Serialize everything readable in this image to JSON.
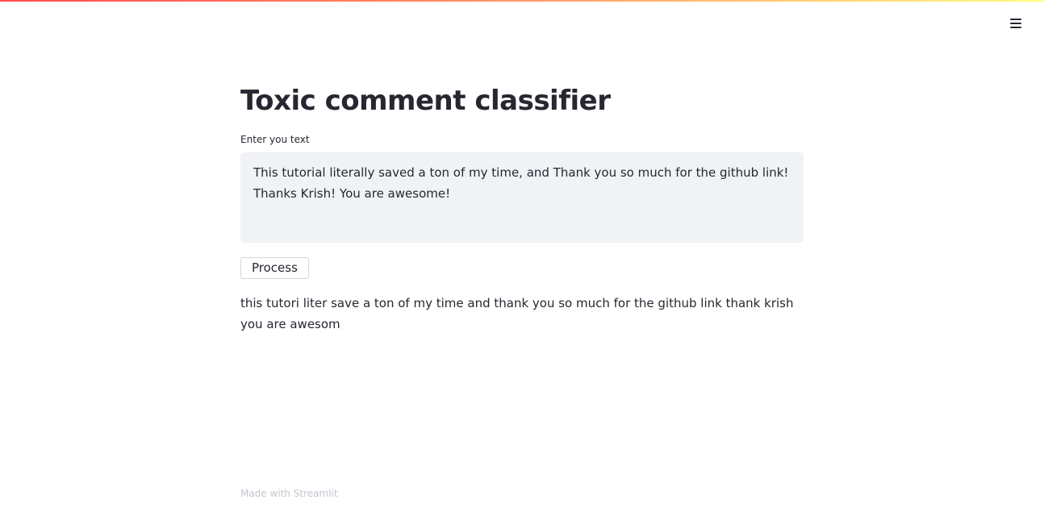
{
  "app": {
    "title": "Toxic comment classifier"
  },
  "menu": {
    "icon": "hamburger-menu-icon"
  },
  "input": {
    "label": "Enter you text",
    "value": "This tutorial literally saved a ton of my time, and Thank you so much for the github link! Thanks Krish! You are awesome!"
  },
  "actions": {
    "process_label": "Process"
  },
  "output": {
    "text": "this tutori liter save a ton of my time and thank you so much for the github link thank krish you are awesom"
  },
  "footer": {
    "text": "Made with Streamlit"
  },
  "colors": {
    "accent_gradient_start": "#ff4b4b",
    "accent_gradient_end": "#fffd80",
    "text": "#262730",
    "input_background": "#f0f2f6",
    "footer_text": "#c4c6cf"
  }
}
